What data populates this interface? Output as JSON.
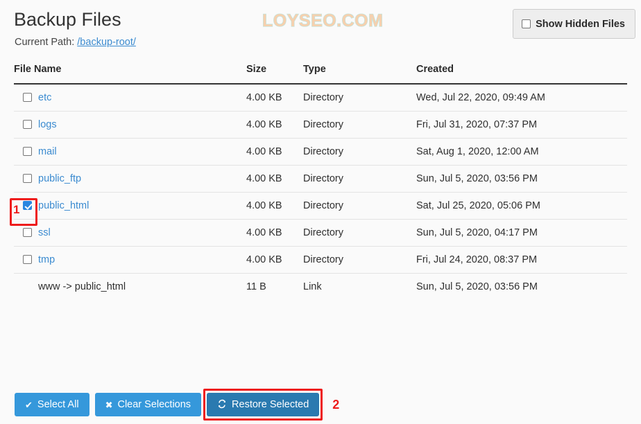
{
  "header": {
    "title": "Backup Files",
    "current_path_label": "Current Path:",
    "current_path_value": "/backup-root/",
    "watermark": "LOYSEO.COM",
    "show_hidden_label": "Show Hidden Files",
    "show_hidden_checked": false
  },
  "table": {
    "columns": [
      "File Name",
      "Size",
      "Type",
      "Created"
    ],
    "rows": [
      {
        "name": "etc",
        "size": "4.00 KB",
        "type": "Directory",
        "created": "Wed, Jul 22, 2020, 09:49 AM",
        "checkbox": true,
        "checked": false,
        "link": true
      },
      {
        "name": "logs",
        "size": "4.00 KB",
        "type": "Directory",
        "created": "Fri, Jul 31, 2020, 07:37 PM",
        "checkbox": true,
        "checked": false,
        "link": true
      },
      {
        "name": "mail",
        "size": "4.00 KB",
        "type": "Directory",
        "created": "Sat, Aug 1, 2020, 12:00 AM",
        "checkbox": true,
        "checked": false,
        "link": true
      },
      {
        "name": "public_ftp",
        "size": "4.00 KB",
        "type": "Directory",
        "created": "Sun, Jul 5, 2020, 03:56 PM",
        "checkbox": true,
        "checked": false,
        "link": true
      },
      {
        "name": "public_html",
        "size": "4.00 KB",
        "type": "Directory",
        "created": "Sat, Jul 25, 2020, 05:06 PM",
        "checkbox": true,
        "checked": true,
        "link": true
      },
      {
        "name": "ssl",
        "size": "4.00 KB",
        "type": "Directory",
        "created": "Sun, Jul 5, 2020, 04:17 PM",
        "checkbox": true,
        "checked": false,
        "link": true
      },
      {
        "name": "tmp",
        "size": "4.00 KB",
        "type": "Directory",
        "created": "Fri, Jul 24, 2020, 08:37 PM",
        "checkbox": true,
        "checked": false,
        "link": true
      },
      {
        "name": "www -> public_html",
        "size": "11 B",
        "type": "Link",
        "created": "Sun, Jul 5, 2020, 03:56 PM",
        "checkbox": false,
        "checked": false,
        "link": false
      }
    ]
  },
  "footer": {
    "select_all_label": "Select All",
    "select_all_icon": "check-icon",
    "clear_selections_label": "Clear Selections",
    "clear_selections_icon": "times-icon",
    "restore_selected_label": "Restore Selected",
    "restore_selected_icon": "refresh-icon"
  },
  "annotations": {
    "marker_1": "1",
    "marker_2": "2",
    "color": "#ee1c1c"
  },
  "colors": {
    "link": "#3b8bd0",
    "primary_button": "#3598db",
    "primary_button_active": "#2a7ab0",
    "page_background": "#fafafa",
    "watermark_fill": "#f6d0ae",
    "watermark_stroke": "#bfe6e0"
  }
}
